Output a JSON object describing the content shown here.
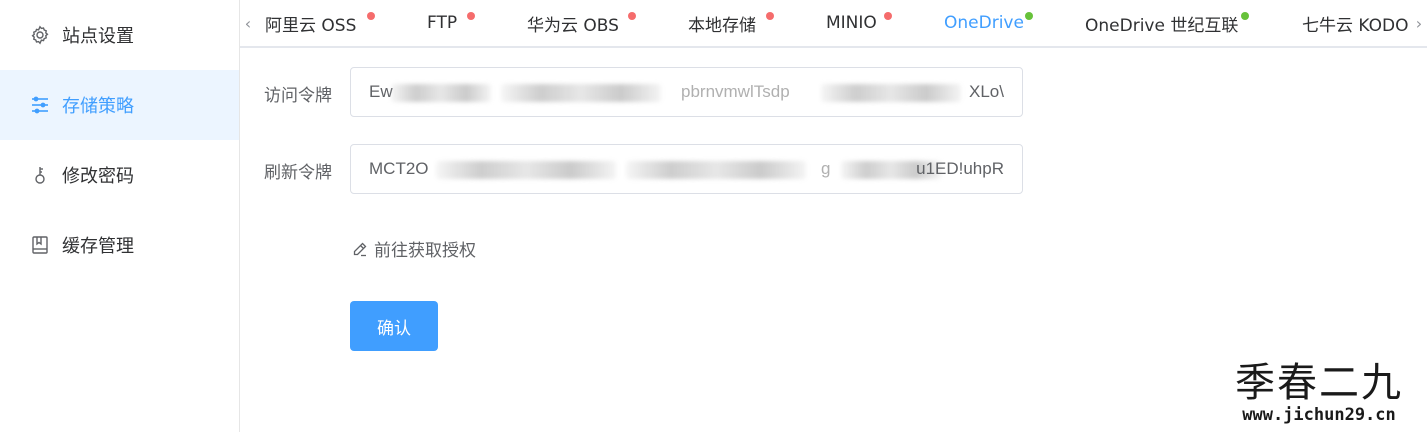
{
  "sidebar": {
    "items": [
      {
        "label": "站点设置",
        "icon": "gear-icon"
      },
      {
        "label": "存储策略",
        "icon": "sliders-icon",
        "active": true
      },
      {
        "label": "修改密码",
        "icon": "key-icon"
      },
      {
        "label": "缓存管理",
        "icon": "book-icon"
      }
    ]
  },
  "tabs": {
    "items": [
      {
        "label": "阿里云 OSS",
        "status": "red"
      },
      {
        "label": "FTP",
        "status": "red"
      },
      {
        "label": "华为云 OBS",
        "status": "red"
      },
      {
        "label": "本地存储",
        "status": "red"
      },
      {
        "label": "MINIO",
        "status": "red"
      },
      {
        "label": "OneDrive",
        "status": "green",
        "active": true
      },
      {
        "label": "OneDrive 世纪互联",
        "status": "green"
      },
      {
        "label": "七牛云 KODO",
        "status": "none"
      }
    ],
    "status_colors": {
      "red": "#f56c6c",
      "green": "#67c23a"
    }
  },
  "form": {
    "access_token_label": "访问令牌",
    "access_token_prefix": "Ew",
    "access_token_middle": "pbrnvmwlTsdp",
    "access_token_suffix": "XLo\\",
    "refresh_token_label": "刷新令牌",
    "refresh_token_prefix": "MCT2O",
    "refresh_token_middle": "g",
    "refresh_token_suffix": "u1ED!uhpR",
    "auth_link_label": "前往获取授权",
    "confirm_label": "确认"
  },
  "watermark": {
    "title": "季春二九",
    "url": "www.jichun29.cn"
  },
  "colors": {
    "accent": "#409eff",
    "active_bg": "#ecf5ff"
  }
}
